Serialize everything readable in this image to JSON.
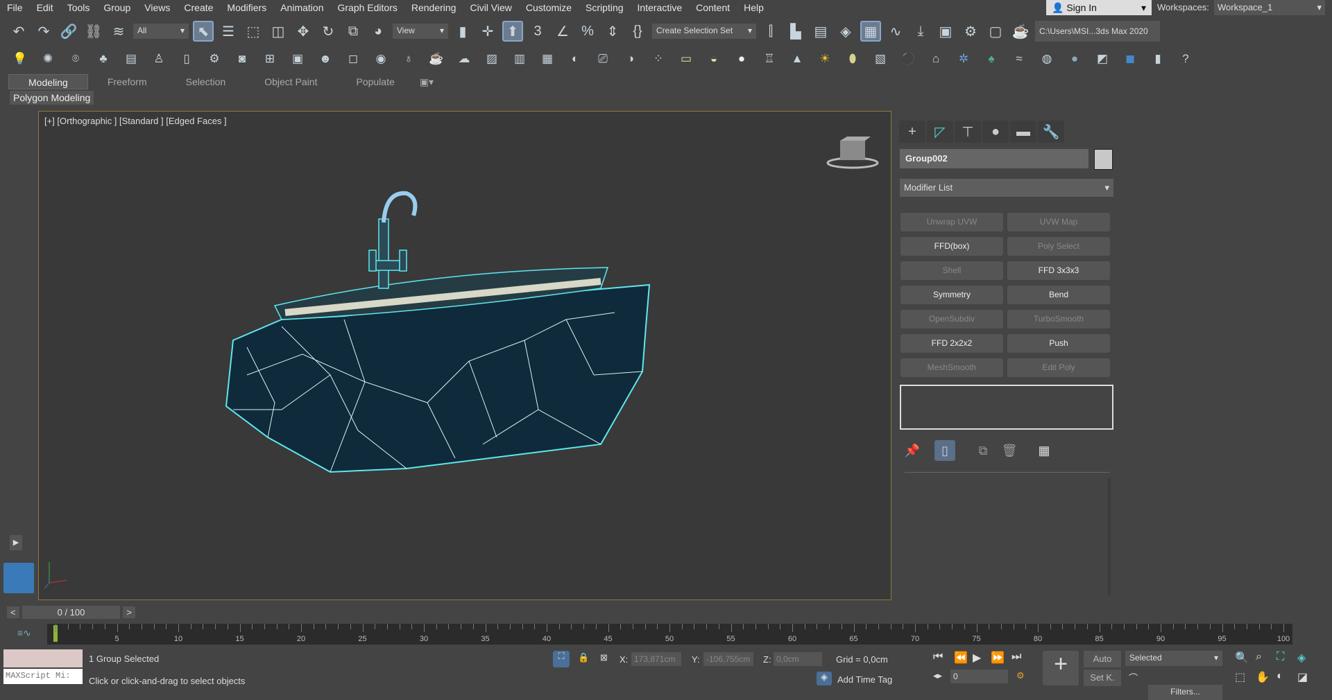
{
  "menu": [
    "File",
    "Edit",
    "Tools",
    "Group",
    "Views",
    "Create",
    "Modifiers",
    "Animation",
    "Graph Editors",
    "Rendering",
    "Civil View",
    "Customize",
    "Scripting",
    "Interactive",
    "Content",
    "Help"
  ],
  "signin": "Sign In",
  "workspaces_label": "Workspaces:",
  "workspace": "Workspace_1",
  "toolbar1": {
    "filter": "All",
    "view": "View",
    "selection_set": "Create Selection Set",
    "path": "C:\\Users\\MSI...3ds Max 2020",
    "icons": [
      "undo-icon",
      "redo-icon",
      "link-icon",
      "unlink-icon",
      "bind-space-warp-icon"
    ]
  },
  "ribbon": {
    "tabs": [
      "Modeling",
      "Freeform",
      "Selection",
      "Object Paint",
      "Populate"
    ],
    "panel": "Polygon Modeling"
  },
  "viewport": {
    "label": "[+] [Orthographic ] [Standard ] [Edged Faces ]"
  },
  "command_panel": {
    "object_name": "Group002",
    "modifier_list": "Modifier List",
    "modifiers": [
      {
        "label": "Unwrap UVW",
        "enabled": false
      },
      {
        "label": "UVW Map",
        "enabled": false
      },
      {
        "label": "FFD(box)",
        "enabled": true
      },
      {
        "label": "Poly Select",
        "enabled": false
      },
      {
        "label": "Shell",
        "enabled": false
      },
      {
        "label": "FFD 3x3x3",
        "enabled": true
      },
      {
        "label": "Symmetry",
        "enabled": true
      },
      {
        "label": "Bend",
        "enabled": true
      },
      {
        "label": "OpenSubdiv",
        "enabled": false
      },
      {
        "label": "TurboSmooth",
        "enabled": false
      },
      {
        "label": "FFD 2x2x2",
        "enabled": true
      },
      {
        "label": "Push",
        "enabled": true
      },
      {
        "label": "MeshSmooth",
        "enabled": false
      },
      {
        "label": "Edit Poly",
        "enabled": false
      }
    ]
  },
  "timeline": {
    "frame": "0 / 100",
    "ticks": [
      "5",
      "10",
      "15",
      "20",
      "25",
      "30",
      "35",
      "40",
      "45",
      "50",
      "55",
      "60",
      "65",
      "70",
      "75",
      "80",
      "85",
      "90",
      "95",
      "100"
    ],
    "max": 100,
    "current": 0
  },
  "status": {
    "selection": "1 Group Selected",
    "prompt": "Click or click-and-drag to select objects",
    "maxscript": "MAXScript Mi:",
    "x_label": "X:",
    "x": "173,871cm",
    "y_label": "Y:",
    "y": "-106,755cm",
    "z_label": "Z:",
    "z": "0,0cm",
    "grid": "Grid = 0,0cm",
    "add_time_tag": "Add Time Tag",
    "frame_field": "0",
    "auto": "Auto",
    "set_key": "Set K.",
    "key_mode": "Selected",
    "filters": "Filters..."
  }
}
